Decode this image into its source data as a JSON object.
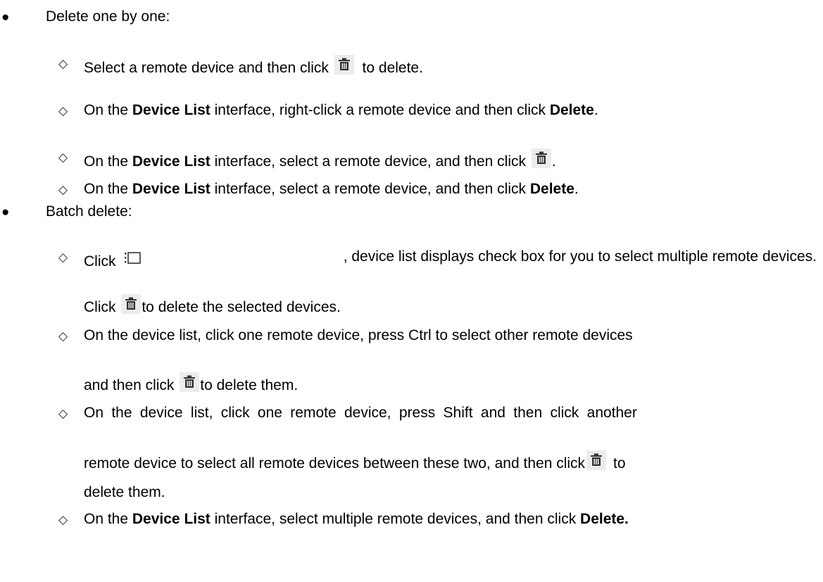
{
  "section1": {
    "heading": "Delete one by one:",
    "items": [
      {
        "a": "Select a remote device and then click ",
        "b": " to delete."
      },
      {
        "a": "On the ",
        "bold1": "Device List",
        "b": " interface, right-click a remote device and then click ",
        "bold2": "Delete",
        "c": "."
      },
      {
        "a": "On the ",
        "bold1": "Device List",
        "b": " interface, select a remote device, and then click ",
        "c": "."
      },
      {
        "a": "On the ",
        "bold1": "Device List",
        "b": " interface, select a remote device, and then click ",
        "bold2": "Delete",
        "c": "."
      }
    ]
  },
  "section2": {
    "heading": "Batch delete:",
    "item1": {
      "a": "Click ",
      "b": ", device list displays check box for you to select multiple remote devices.",
      "line2a": "Click ",
      "line2b": "to delete the selected devices."
    },
    "item2": {
      "line1": "On the device list, click one remote device, press Ctrl to select other remote devices",
      "line2a": "and then click ",
      "line2b": "to delete them."
    },
    "item3": {
      "line1": "On the device list, click one remote device, press Shift and then click another",
      "line2a": "remote device to select all remote devices between these two, and then click",
      "line2b": "to",
      "line3": "delete them."
    },
    "item4": {
      "a": "On the ",
      "bold1": "Device List",
      "b": " interface, select multiple remote devices, and then click ",
      "bold2": "Delete."
    }
  },
  "symbols": {
    "bullet": "●",
    "diamond": "◇"
  },
  "icons": {
    "delete": "trash-icon",
    "multi_select": "checklist-icon"
  },
  "colors": {
    "icon_bg": "#ececec",
    "icon_fg": "#333333"
  }
}
